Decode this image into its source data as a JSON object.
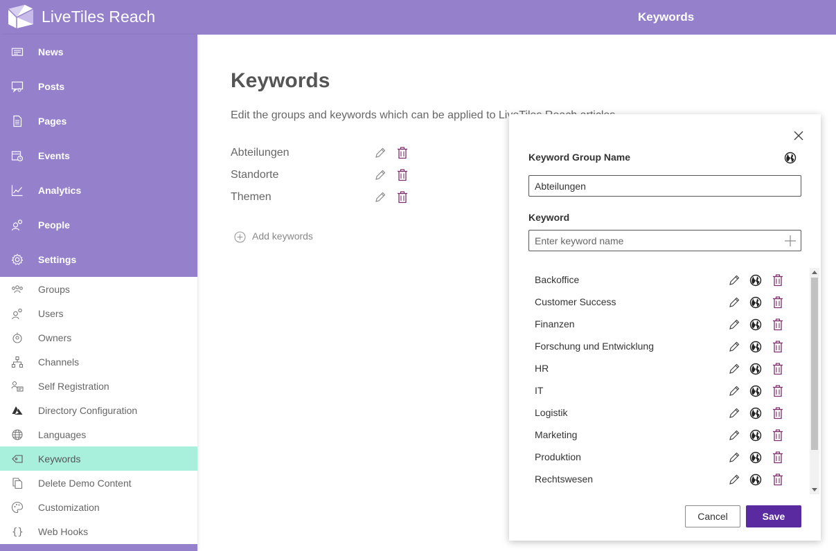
{
  "header": {
    "app_title": "LiveTiles Reach",
    "page_title": "Keywords"
  },
  "sidebar": {
    "main": [
      {
        "label": "News",
        "icon": "news-icon"
      },
      {
        "label": "Posts",
        "icon": "posts-icon"
      },
      {
        "label": "Pages",
        "icon": "pages-icon"
      },
      {
        "label": "Events",
        "icon": "events-icon"
      },
      {
        "label": "Analytics",
        "icon": "analytics-icon"
      },
      {
        "label": "People",
        "icon": "people-icon"
      },
      {
        "label": "Settings",
        "icon": "gear-icon"
      }
    ],
    "settings": [
      {
        "label": "Groups",
        "icon": "groups-icon"
      },
      {
        "label": "Users",
        "icon": "users-icon"
      },
      {
        "label": "Owners",
        "icon": "owners-icon"
      },
      {
        "label": "Channels",
        "icon": "channels-icon"
      },
      {
        "label": "Self Registration",
        "icon": "self-registration-icon"
      },
      {
        "label": "Directory Configuration",
        "icon": "azure-icon"
      },
      {
        "label": "Languages",
        "icon": "globe-icon"
      },
      {
        "label": "Keywords",
        "icon": "tag-icon",
        "active": true
      },
      {
        "label": "Delete Demo Content",
        "icon": "copy-icon"
      },
      {
        "label": "Customization",
        "icon": "palette-icon"
      },
      {
        "label": "Web Hooks",
        "icon": "braces-icon"
      }
    ]
  },
  "main": {
    "title": "Keywords",
    "description": "Edit the groups and keywords which can be applied to LiveTiles Reach articles.",
    "groups": [
      "Abteilungen",
      "Standorte",
      "Themen"
    ],
    "add_label": "Add keywords"
  },
  "modal": {
    "group_name_label": "Keyword Group Name",
    "group_name_value": "Abteilungen",
    "keyword_label": "Keyword",
    "keyword_placeholder": "Enter keyword name",
    "keywords": [
      "Backoffice",
      "Customer Success",
      "Finanzen",
      "Forschung und Entwicklung",
      "HR",
      "IT",
      "Logistik",
      "Marketing",
      "Produktion",
      "Rechtswesen"
    ],
    "cancel_label": "Cancel",
    "save_label": "Save"
  },
  "colors": {
    "brand": "#9580cb",
    "active_item": "#a8efdc",
    "primary_button": "#5a2ba0",
    "delete_icon": "#7a2e6a"
  }
}
